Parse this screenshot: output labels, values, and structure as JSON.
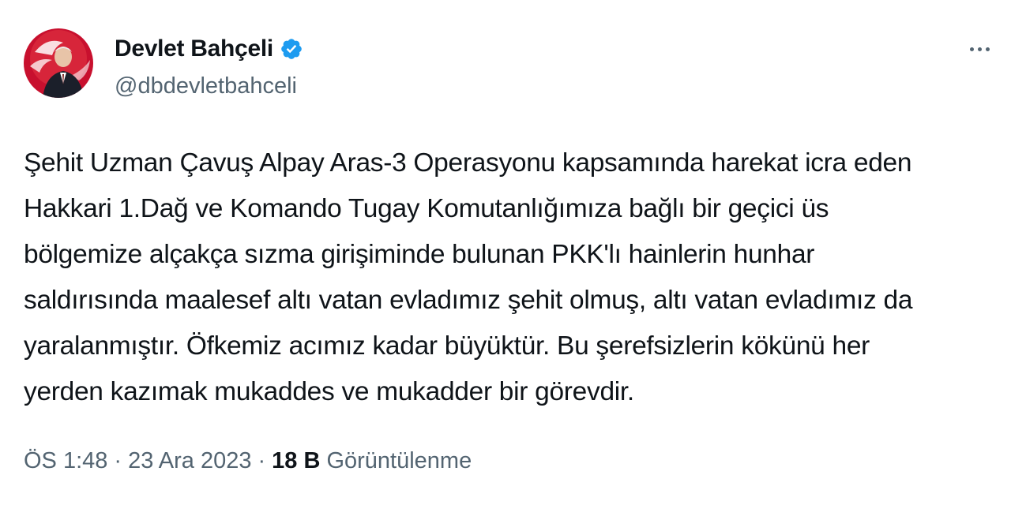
{
  "tweet": {
    "author": {
      "display_name": "Devlet Bahçeli",
      "handle": "@dbdevletbahceli",
      "verified": true,
      "verified_color": "#1d9bf0"
    },
    "more_icon": "more-horizontal-icon",
    "text": "Şehit Uzman Çavuş Alpay Aras-3 Operasyonu kapsamında harekat icra eden\nHakkari 1.Dağ ve Komando Tugay Komutanlığımıza bağlı bir geçici üs\nbölgemize alçakça sızma girişiminde bulunan PKK'lı hainlerin hunhar\nsaldırısında maalesef altı vatan evladımız şehit olmuş, altı vatan evladımız da\nyaralanmıştır. Öfkemiz acımız kadar büyüktür. Bu şerefsizlerin kökünü her\nyerden kazımak mukaddes ve mukadder bir görevdir.",
    "meta": {
      "time": "ÖS 1:48",
      "separator": "·",
      "date": "23 Ara 2023",
      "views_count": "18 B",
      "views_label": "Görüntülenme"
    },
    "colors": {
      "text": "#0f1419",
      "secondary": "#536471",
      "avatar_bg": "#c8102e"
    }
  }
}
